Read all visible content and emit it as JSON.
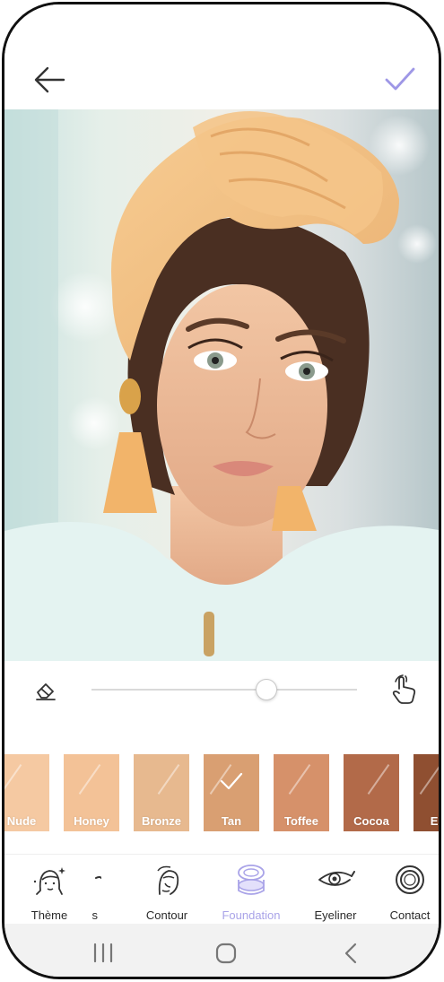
{
  "header": {
    "back_icon": "arrow-left-icon",
    "confirm_icon": "checkmark-icon",
    "accent_color": "#9e97e6"
  },
  "adjust": {
    "eraser_icon": "eraser-icon",
    "intensity": 0.66,
    "gesture_icon": "touch-hand-icon"
  },
  "swatches": [
    {
      "label": "Nude",
      "color": "#f5c9a2",
      "selected": false
    },
    {
      "label": "Honey",
      "color": "#f3c297",
      "selected": false
    },
    {
      "label": "Bronze",
      "color": "#e7b98f",
      "selected": false
    },
    {
      "label": "Tan",
      "color": "#d99f72",
      "selected": true
    },
    {
      "label": "Toffee",
      "color": "#d6916a",
      "selected": false
    },
    {
      "label": "Cocoa",
      "color": "#b26a49",
      "selected": false
    },
    {
      "label": "Ebo",
      "color": "#8f4f31",
      "selected": false
    }
  ],
  "nav": {
    "items": [
      {
        "label": "Thème",
        "icon": "theme-face-icon",
        "active": false
      },
      {
        "label": "s",
        "icon": "brow-icon",
        "active": false
      },
      {
        "label": "Contour",
        "icon": "contour-face-icon",
        "active": false
      },
      {
        "label": "Foundation",
        "icon": "foundation-compact-icon",
        "active": true
      },
      {
        "label": "Eyeliner",
        "icon": "eyeliner-icon",
        "active": false
      },
      {
        "label": "Contact",
        "icon": "contact-lens-icon",
        "active": false
      }
    ]
  },
  "system_nav": {
    "recents_icon": "recent-apps-icon",
    "home_icon": "home-icon",
    "back_icon": "system-back-icon"
  }
}
